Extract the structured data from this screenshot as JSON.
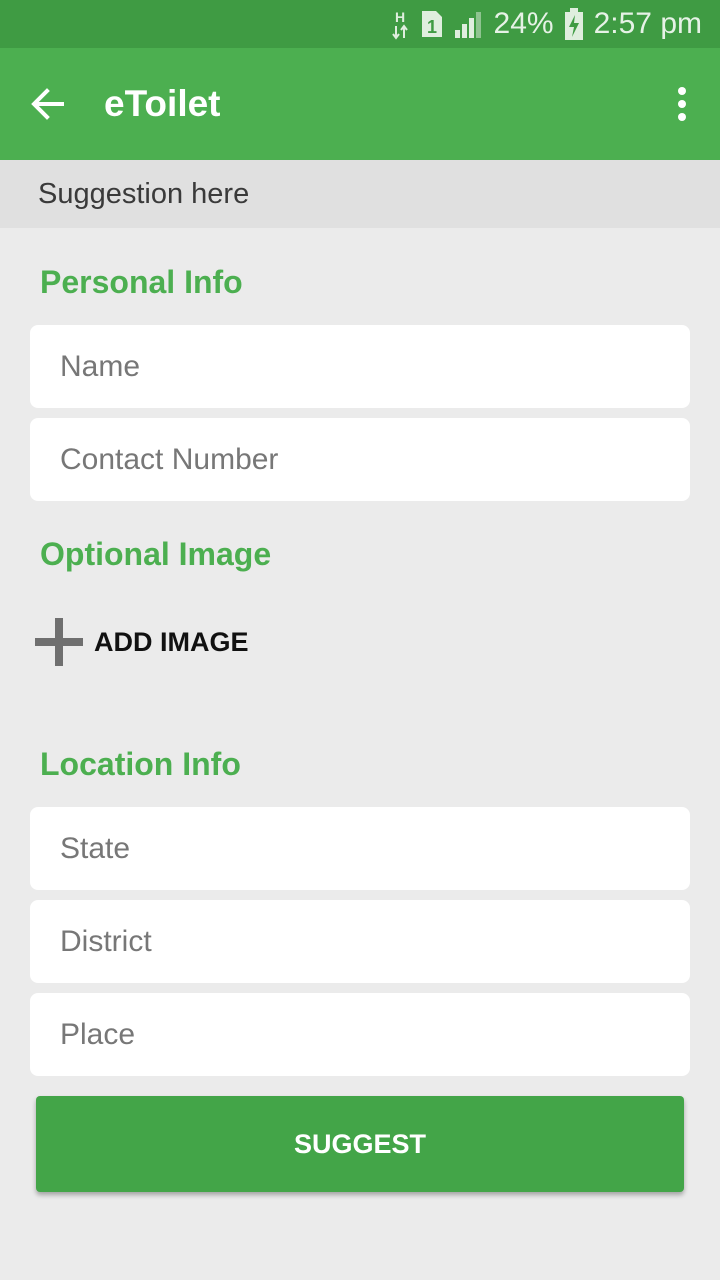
{
  "status_bar": {
    "network_label": "H",
    "sim_label": "1",
    "battery": "24%",
    "time": "2:57 pm"
  },
  "app_bar": {
    "title": "eToilet"
  },
  "subheader": "Suggestion here",
  "personal_info": {
    "title": "Personal Info",
    "name_placeholder": "Name",
    "contact_placeholder": "Contact Number"
  },
  "optional_image": {
    "title": "Optional Image",
    "add_label": "ADD IMAGE"
  },
  "location_info": {
    "title": "Location Info",
    "state_placeholder": "State",
    "district_placeholder": "District",
    "place_placeholder": "Place"
  },
  "suggest_label": "SUGGEST",
  "colors": {
    "primary": "#4caf50",
    "primary_dark": "#3f9b43",
    "button": "#43a548"
  }
}
